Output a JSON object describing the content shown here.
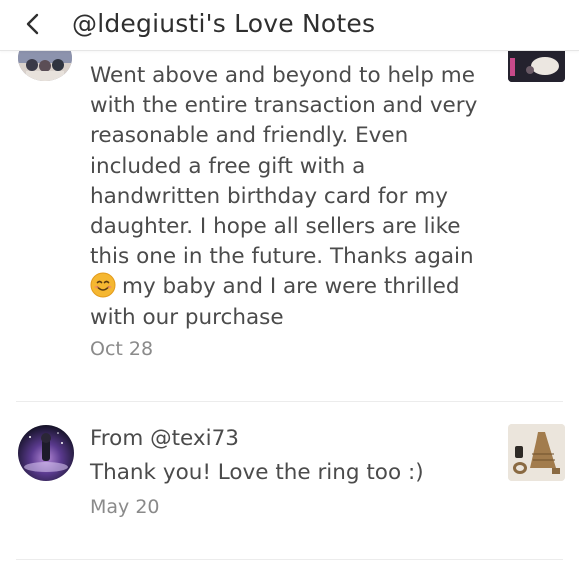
{
  "header": {
    "title": "@ldegiusti's Love Notes",
    "back_icon": "chevron-left-icon"
  },
  "notes": [
    {
      "lines": [
        "Went above and beyond to help me",
        "with the entire transaction and very",
        "reasonable and friendly. Even",
        "included a free gift with a",
        "handwritten birthday card for my",
        "daughter. I hope all sellers are like",
        "this one in the future. Thanks again"
      ],
      "emoji_line_text": "my baby and I are were thrilled",
      "last_line": "with our purchase",
      "emoji_icon": "smiling-face-emoji-icon",
      "date": "Oct 28"
    },
    {
      "from": "From @texi73",
      "text": "Thank you! Love the ring too :)",
      "date": "May 20"
    }
  ],
  "colors": {
    "text": "#4b4b4b",
    "muted": "#8a8a8a",
    "divider": "#ececec",
    "emoji": "#f5b731"
  }
}
